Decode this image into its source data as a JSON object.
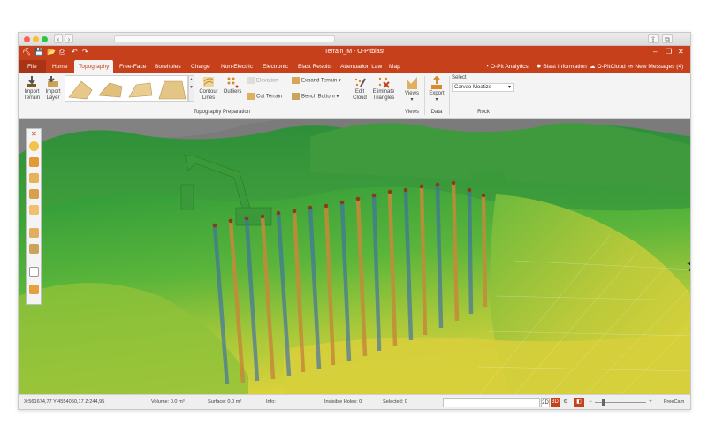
{
  "window": {
    "title": "Terrain_M - O-Pitblast"
  },
  "menu": {
    "file": "File",
    "tabs": [
      "Home",
      "Topography",
      "Free-Face",
      "Boreholes",
      "Charge",
      "Non-Electric",
      "Electronic",
      "Blast Results",
      "Attenuation Law",
      "Map"
    ],
    "active_tab": "Topography",
    "right_links": [
      "O-Pit Analytics",
      "Blast Information",
      "O-PitCloud",
      "New Messages (4)"
    ]
  },
  "ribbon": {
    "import_terrain": "Import\nTerrain",
    "import_layer": "Import\nLayer",
    "contour_lines": "Contour\nLines",
    "outliers": "Outliers",
    "elevation": "Elevation",
    "cut_terrain": "Cut Terrain",
    "expand_terrain": "Expand Terrain",
    "bench_bottom": "Bench Bottom",
    "edit_cloud": "Edit\nCloud",
    "eliminate_triangles": "Eliminate\nTriangles",
    "views": "Views",
    "export": "Export",
    "select_label": "Select",
    "rock_value": "Carvao Moatize",
    "groups": {
      "topography_preparation": "Topography Preparation",
      "views": "Views",
      "data": "Data",
      "rock": "Rock"
    }
  },
  "status": {
    "coords": "X:561674,77   Y:4554050,17   Z:244,95",
    "volume": "Volume: 0.0 m³",
    "surface": "Surface: 0.0 m²",
    "info": "Info:",
    "invisible_holes": "Invisible Holes: 0",
    "selected": "Selected: 0",
    "view_2d": "2D",
    "view_3d": "3D",
    "camera": "FreeCam"
  },
  "colors": {
    "brand": "#c7401c",
    "terrain_high": "#3aa83a",
    "terrain_low": "#d8d23a"
  }
}
